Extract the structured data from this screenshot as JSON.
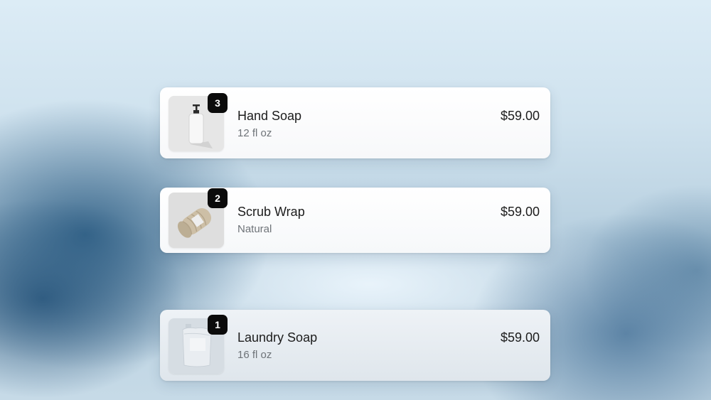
{
  "cart": {
    "items": [
      {
        "name": "Hand Soap",
        "variant": "12 fl oz",
        "price": "$59.00",
        "quantity": "3",
        "image_icon": "pump-bottle-icon"
      },
      {
        "name": "Scrub Wrap",
        "variant": "Natural",
        "price": "$59.00",
        "quantity": "2",
        "image_icon": "rolled-towel-icon"
      },
      {
        "name": "Laundry Soap",
        "variant": "16 fl oz",
        "price": "$59.00",
        "quantity": "1",
        "image_icon": "pouch-icon"
      }
    ]
  },
  "colors": {
    "badge_background": "#0b0b0b",
    "card_background": "#ffffff",
    "text_primary": "#1c1c1c",
    "text_secondary": "#6e7378"
  }
}
